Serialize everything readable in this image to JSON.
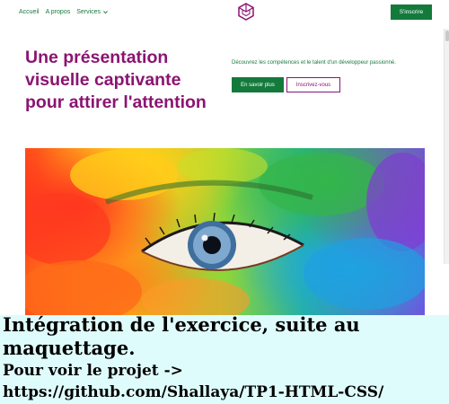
{
  "nav": {
    "links": [
      "Accueil",
      "A propos",
      "Services"
    ],
    "signup_label": "S'inscrire"
  },
  "hero": {
    "title": "Une présentation visuelle captivante pour attirer l'attention",
    "description": "Découvrez les compétences et le talent d'un développeur passionné.",
    "primary_button": "En savoir plus",
    "secondary_button": "Inscrivez-vous"
  },
  "caption": {
    "line1": "Intégration de l'exercice, suite au maquettage.",
    "line2": "Pour voir le projet -> https://github.com/Shallaya/TP1-HTML-CSS/"
  },
  "colors": {
    "brand_green": "#137a3c",
    "brand_purple": "#8b1472",
    "caption_bg": "#dffcfd"
  },
  "icons": {
    "logo": "cube-logo-icon",
    "dropdown": "chevron-down-icon"
  }
}
